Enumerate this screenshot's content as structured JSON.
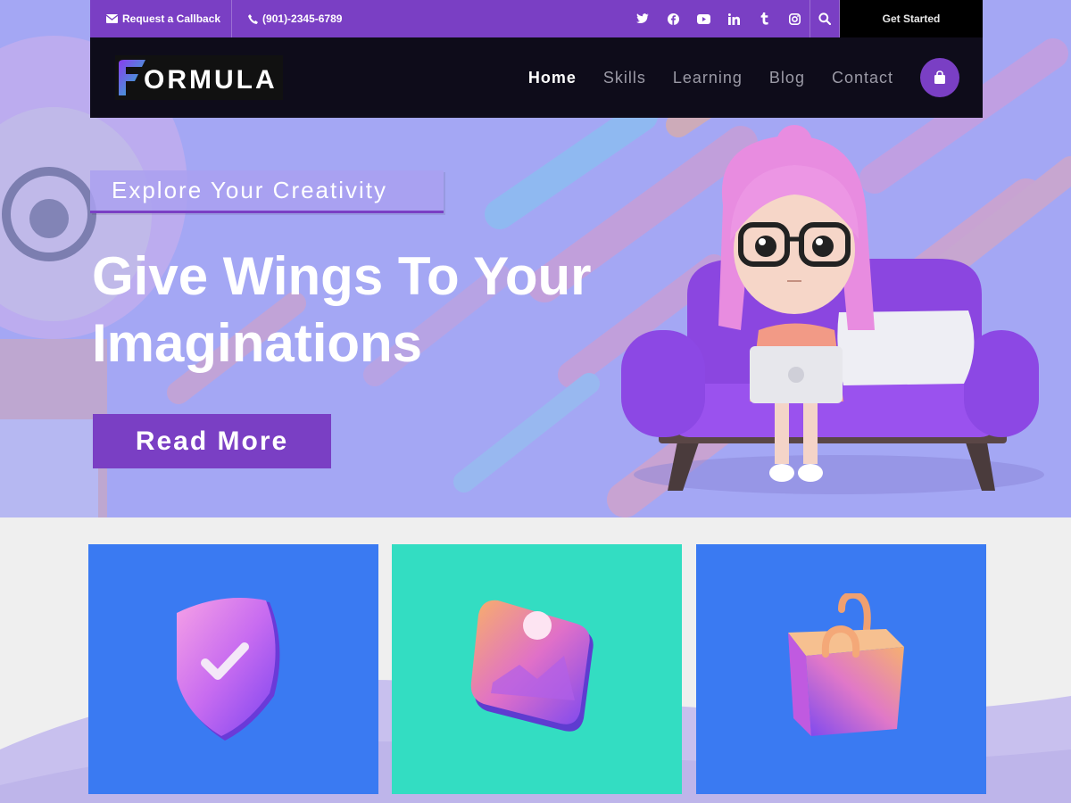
{
  "topbar": {
    "callback_label": "Request a Callback",
    "phone": "(901)-2345-6789",
    "social_icons": [
      "twitter-icon",
      "facebook-icon",
      "youtube-icon",
      "linkedin-icon",
      "tumblr-icon",
      "instagram-icon"
    ],
    "get_started_label": "Get Started"
  },
  "brand": {
    "logo_f": "F",
    "logo_rest": "ORMULA"
  },
  "nav": {
    "items": [
      "Home",
      "Skills",
      "Learning",
      "Blog",
      "Contact"
    ],
    "active": "Home"
  },
  "hero": {
    "tagline": "Explore Your Creativity",
    "title_line1": "Give Wings To Your",
    "title_line2": "Imaginations",
    "button_label": "Read More"
  },
  "cards": [
    {
      "icon": "shield-check-icon",
      "color": "#3a7af2"
    },
    {
      "icon": "image-icon",
      "color": "#33ddc2"
    },
    {
      "icon": "shopping-bag-icon",
      "color": "#3a7af2"
    }
  ],
  "colors": {
    "accent": "#7a3fc4",
    "hero_bg": "#a4a7f4",
    "nav_bg": "#0e0c1a"
  }
}
